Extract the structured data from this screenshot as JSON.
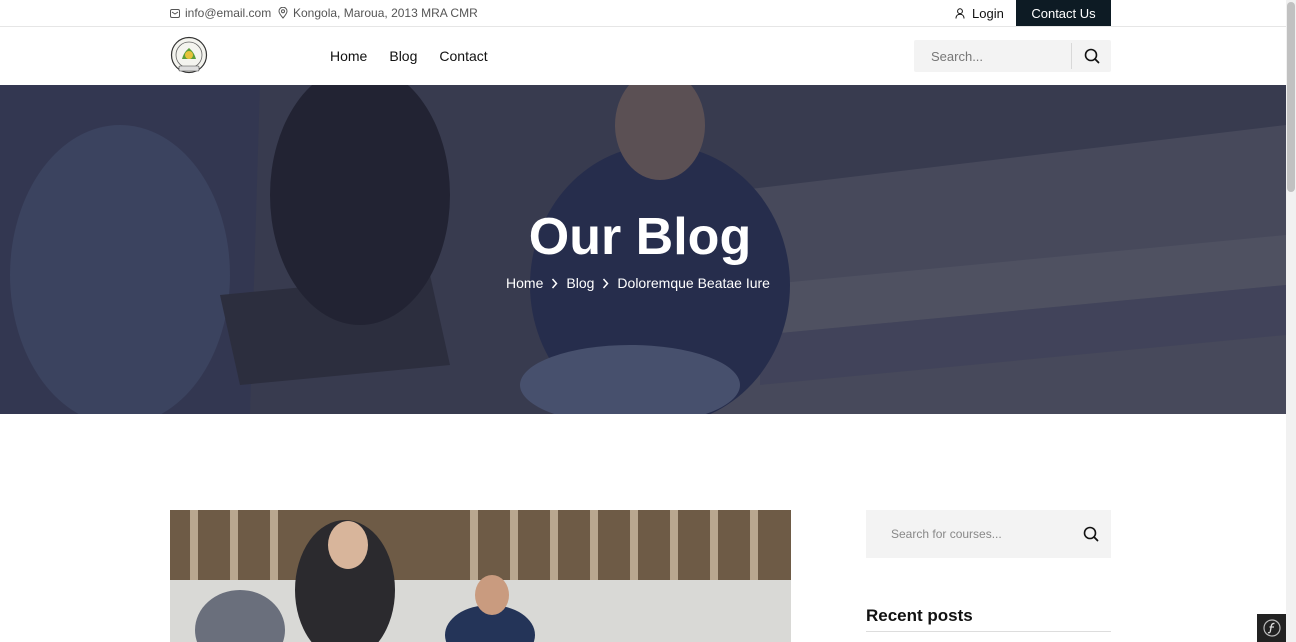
{
  "topbar": {
    "email": "info@email.com",
    "address": "Kongola, Maroua, 2013 MRA CMR",
    "login_label": "Login",
    "contact_label": "Contact Us"
  },
  "nav": {
    "items": [
      "Home",
      "Blog",
      "Contact"
    ],
    "search_placeholder": "Search..."
  },
  "hero": {
    "title": "Our Blog",
    "breadcrumb": [
      "Home",
      "Blog",
      "Doloremque Beatae Iure"
    ]
  },
  "sidebar": {
    "search_placeholder": "Search for courses...",
    "recent_posts_title": "Recent posts"
  },
  "colors": {
    "dark_button": "#0d1b24",
    "hero_overlay": "#3b3f52"
  }
}
